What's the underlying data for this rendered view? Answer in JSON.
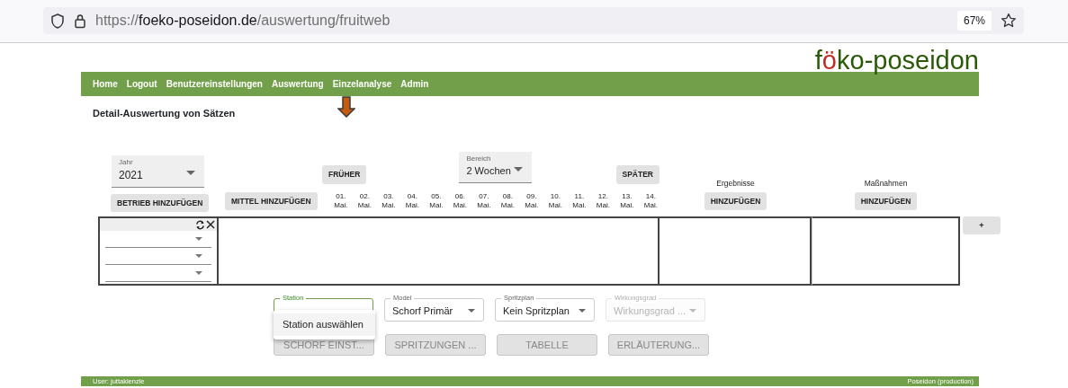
{
  "browser": {
    "url_scheme": "https://",
    "url_host": "foeko-poseidon.de",
    "url_path": "/auswertung/fruitweb",
    "zoom": "67%"
  },
  "logo": [
    {
      "text": "f",
      "accent": false
    },
    {
      "text": "ö",
      "accent": true
    },
    {
      "text": "ko-poseidon",
      "accent": false
    }
  ],
  "nav": [
    "Home",
    "Logout",
    "Benutzereinstellungen",
    "Auswertung",
    "Einzelanalyse",
    "Admin"
  ],
  "page_title": "Detail-Auswertung von Sätzen",
  "year_select": {
    "label": "Jahr",
    "value": "2021"
  },
  "earlier_button": "FRÜHER",
  "range_select": {
    "label": "Bereich",
    "value": "2 Wochen"
  },
  "later_button": "SPÄTER",
  "add_farm_button": "BETRIEB HINZUFÜGEN",
  "add_agent_button": "MITTEL HINZUFÜGEN",
  "dates": [
    {
      "day": "01.",
      "month": "Mai."
    },
    {
      "day": "02.",
      "month": "Mai."
    },
    {
      "day": "03.",
      "month": "Mai."
    },
    {
      "day": "04.",
      "month": "Mai."
    },
    {
      "day": "05.",
      "month": "Mai."
    },
    {
      "day": "06.",
      "month": "Mai."
    },
    {
      "day": "07.",
      "month": "Mai."
    },
    {
      "day": "08.",
      "month": "Mai."
    },
    {
      "day": "09.",
      "month": "Mai."
    },
    {
      "day": "10.",
      "month": "Mai."
    },
    {
      "day": "11.",
      "month": "Mai."
    },
    {
      "day": "12.",
      "month": "Mai."
    },
    {
      "day": "13.",
      "month": "Mai."
    },
    {
      "day": "14.",
      "month": "Mai."
    }
  ],
  "sections": [
    {
      "title": "Ergebnisse",
      "button": "HINZUFÜGEN"
    },
    {
      "title": "Maßnahmen",
      "button": "HINZUFÜGEN"
    }
  ],
  "filter_selects": [
    {
      "kind": "select"
    },
    {
      "kind": "select"
    },
    {
      "kind": "select"
    }
  ],
  "add_column_button": "+",
  "settings_selects": [
    {
      "label": "Station",
      "focused": true,
      "disabled": false
    },
    {
      "label": "Model",
      "value": "Schorf Primär",
      "focused": false,
      "disabled": false
    },
    {
      "label": "Spritzplan",
      "value": "Kein Spritzplan",
      "focused": false,
      "disabled": false
    },
    {
      "label": "Wirkungsgrad",
      "placeholder": "Wirkungsgrad ...",
      "focused": false,
      "disabled": true
    }
  ],
  "station_menu": [
    "Station auswählen"
  ],
  "action_buttons": [
    {
      "label": "SCHORF EINST...",
      "disabled": true
    },
    {
      "label": "SPRITZUNGEN ...",
      "disabled": true
    },
    {
      "label": "TABELLE",
      "disabled": true
    },
    {
      "label": "ERLÄUTERUNG...",
      "disabled": true
    }
  ],
  "footer": {
    "user": "User: juttakienzle",
    "instance": "Poseidon (production)"
  }
}
